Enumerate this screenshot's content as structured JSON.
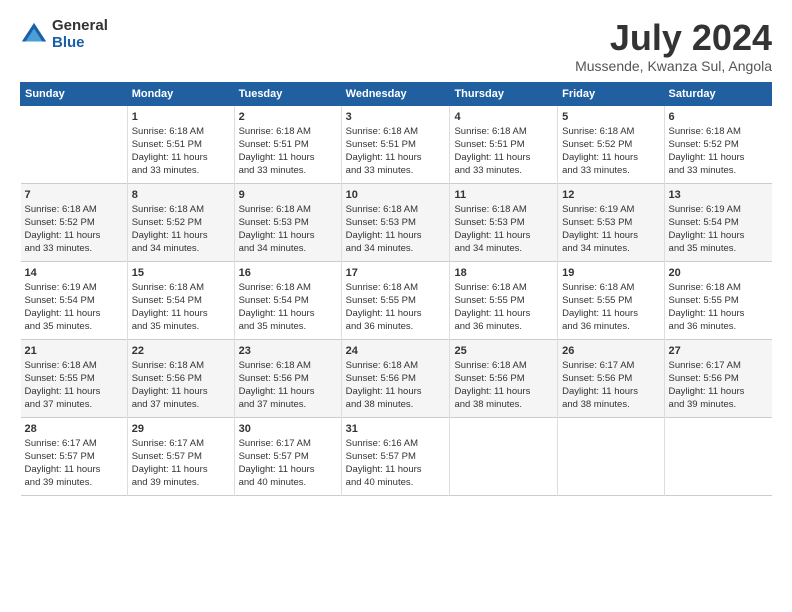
{
  "logo": {
    "general": "General",
    "blue": "Blue"
  },
  "title": "July 2024",
  "subtitle": "Mussende, Kwanza Sul, Angola",
  "days_header": [
    "Sunday",
    "Monday",
    "Tuesday",
    "Wednesday",
    "Thursday",
    "Friday",
    "Saturday"
  ],
  "weeks": [
    [
      {
        "day": "",
        "lines": []
      },
      {
        "day": "1",
        "lines": [
          "Sunrise: 6:18 AM",
          "Sunset: 5:51 PM",
          "Daylight: 11 hours",
          "and 33 minutes."
        ]
      },
      {
        "day": "2",
        "lines": [
          "Sunrise: 6:18 AM",
          "Sunset: 5:51 PM",
          "Daylight: 11 hours",
          "and 33 minutes."
        ]
      },
      {
        "day": "3",
        "lines": [
          "Sunrise: 6:18 AM",
          "Sunset: 5:51 PM",
          "Daylight: 11 hours",
          "and 33 minutes."
        ]
      },
      {
        "day": "4",
        "lines": [
          "Sunrise: 6:18 AM",
          "Sunset: 5:51 PM",
          "Daylight: 11 hours",
          "and 33 minutes."
        ]
      },
      {
        "day": "5",
        "lines": [
          "Sunrise: 6:18 AM",
          "Sunset: 5:52 PM",
          "Daylight: 11 hours",
          "and 33 minutes."
        ]
      },
      {
        "day": "6",
        "lines": [
          "Sunrise: 6:18 AM",
          "Sunset: 5:52 PM",
          "Daylight: 11 hours",
          "and 33 minutes."
        ]
      }
    ],
    [
      {
        "day": "7",
        "lines": [
          "Sunrise: 6:18 AM",
          "Sunset: 5:52 PM",
          "Daylight: 11 hours",
          "and 33 minutes."
        ]
      },
      {
        "day": "8",
        "lines": [
          "Sunrise: 6:18 AM",
          "Sunset: 5:52 PM",
          "Daylight: 11 hours",
          "and 34 minutes."
        ]
      },
      {
        "day": "9",
        "lines": [
          "Sunrise: 6:18 AM",
          "Sunset: 5:53 PM",
          "Daylight: 11 hours",
          "and 34 minutes."
        ]
      },
      {
        "day": "10",
        "lines": [
          "Sunrise: 6:18 AM",
          "Sunset: 5:53 PM",
          "Daylight: 11 hours",
          "and 34 minutes."
        ]
      },
      {
        "day": "11",
        "lines": [
          "Sunrise: 6:18 AM",
          "Sunset: 5:53 PM",
          "Daylight: 11 hours",
          "and 34 minutes."
        ]
      },
      {
        "day": "12",
        "lines": [
          "Sunrise: 6:19 AM",
          "Sunset: 5:53 PM",
          "Daylight: 11 hours",
          "and 34 minutes."
        ]
      },
      {
        "day": "13",
        "lines": [
          "Sunrise: 6:19 AM",
          "Sunset: 5:54 PM",
          "Daylight: 11 hours",
          "and 35 minutes."
        ]
      }
    ],
    [
      {
        "day": "14",
        "lines": [
          "Sunrise: 6:19 AM",
          "Sunset: 5:54 PM",
          "Daylight: 11 hours",
          "and 35 minutes."
        ]
      },
      {
        "day": "15",
        "lines": [
          "Sunrise: 6:18 AM",
          "Sunset: 5:54 PM",
          "Daylight: 11 hours",
          "and 35 minutes."
        ]
      },
      {
        "day": "16",
        "lines": [
          "Sunrise: 6:18 AM",
          "Sunset: 5:54 PM",
          "Daylight: 11 hours",
          "and 35 minutes."
        ]
      },
      {
        "day": "17",
        "lines": [
          "Sunrise: 6:18 AM",
          "Sunset: 5:55 PM",
          "Daylight: 11 hours",
          "and 36 minutes."
        ]
      },
      {
        "day": "18",
        "lines": [
          "Sunrise: 6:18 AM",
          "Sunset: 5:55 PM",
          "Daylight: 11 hours",
          "and 36 minutes."
        ]
      },
      {
        "day": "19",
        "lines": [
          "Sunrise: 6:18 AM",
          "Sunset: 5:55 PM",
          "Daylight: 11 hours",
          "and 36 minutes."
        ]
      },
      {
        "day": "20",
        "lines": [
          "Sunrise: 6:18 AM",
          "Sunset: 5:55 PM",
          "Daylight: 11 hours",
          "and 36 minutes."
        ]
      }
    ],
    [
      {
        "day": "21",
        "lines": [
          "Sunrise: 6:18 AM",
          "Sunset: 5:55 PM",
          "Daylight: 11 hours",
          "and 37 minutes."
        ]
      },
      {
        "day": "22",
        "lines": [
          "Sunrise: 6:18 AM",
          "Sunset: 5:56 PM",
          "Daylight: 11 hours",
          "and 37 minutes."
        ]
      },
      {
        "day": "23",
        "lines": [
          "Sunrise: 6:18 AM",
          "Sunset: 5:56 PM",
          "Daylight: 11 hours",
          "and 37 minutes."
        ]
      },
      {
        "day": "24",
        "lines": [
          "Sunrise: 6:18 AM",
          "Sunset: 5:56 PM",
          "Daylight: 11 hours",
          "and 38 minutes."
        ]
      },
      {
        "day": "25",
        "lines": [
          "Sunrise: 6:18 AM",
          "Sunset: 5:56 PM",
          "Daylight: 11 hours",
          "and 38 minutes."
        ]
      },
      {
        "day": "26",
        "lines": [
          "Sunrise: 6:17 AM",
          "Sunset: 5:56 PM",
          "Daylight: 11 hours",
          "and 38 minutes."
        ]
      },
      {
        "day": "27",
        "lines": [
          "Sunrise: 6:17 AM",
          "Sunset: 5:56 PM",
          "Daylight: 11 hours",
          "and 39 minutes."
        ]
      }
    ],
    [
      {
        "day": "28",
        "lines": [
          "Sunrise: 6:17 AM",
          "Sunset: 5:57 PM",
          "Daylight: 11 hours",
          "and 39 minutes."
        ]
      },
      {
        "day": "29",
        "lines": [
          "Sunrise: 6:17 AM",
          "Sunset: 5:57 PM",
          "Daylight: 11 hours",
          "and 39 minutes."
        ]
      },
      {
        "day": "30",
        "lines": [
          "Sunrise: 6:17 AM",
          "Sunset: 5:57 PM",
          "Daylight: 11 hours",
          "and 40 minutes."
        ]
      },
      {
        "day": "31",
        "lines": [
          "Sunrise: 6:16 AM",
          "Sunset: 5:57 PM",
          "Daylight: 11 hours",
          "and 40 minutes."
        ]
      },
      {
        "day": "",
        "lines": []
      },
      {
        "day": "",
        "lines": []
      },
      {
        "day": "",
        "lines": []
      }
    ]
  ]
}
